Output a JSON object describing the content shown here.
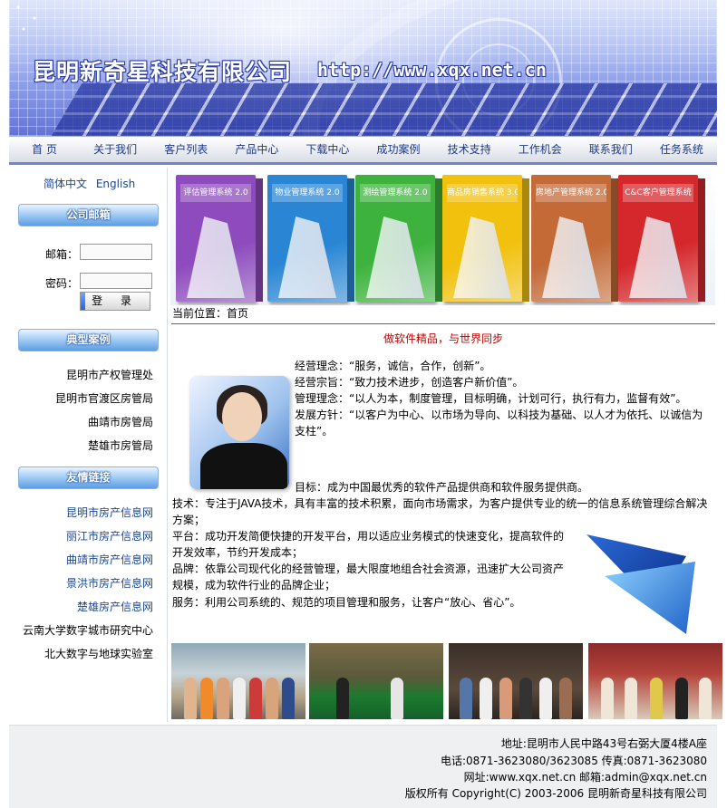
{
  "banner": {
    "company_name": "昆明新奇星科技有限公司",
    "url": "http://www.xqx.net.cn"
  },
  "nav": {
    "items": [
      "首 页",
      "关于我们",
      "客户列表",
      "产品中心",
      "下载中心",
      "成功案例",
      "技术支持",
      "工作机会",
      "联系我们",
      "任务系统"
    ]
  },
  "sidebar": {
    "lang": {
      "zh": "简体中文",
      "en": "English"
    },
    "mail_header": "公司邮箱",
    "email_label": "邮箱：",
    "password_label": "密码：",
    "email_value": "",
    "password_value": "",
    "login_button": "登 录",
    "cases_header": "典型案例",
    "cases": [
      "昆明市产权管理处",
      "昆明市官渡区房管局",
      "曲靖市房管局",
      "楚雄市房管局"
    ],
    "links_header": "友情链接",
    "links": [
      "昆明市房产信息网",
      "丽江市房产信息网",
      "曲靖市房产信息网",
      "景洪市房产信息网",
      "楚雄房产信息网",
      "云南大学数字城市研究中心",
      "北大数字与地球实验室"
    ]
  },
  "products": [
    {
      "title": "评估管理系统",
      "version": "2.0",
      "color": "#8d4bbd"
    },
    {
      "title": "物业管理系统",
      "version": "2.0",
      "color": "#2a86d4"
    },
    {
      "title": "测绘管理系统",
      "version": "2.0",
      "color": "#3db33d"
    },
    {
      "title": "商品房销售系统",
      "version": "3.0",
      "color": "#f1c10e"
    },
    {
      "title": "房地产管理系统",
      "version": "2.0",
      "color": "#c36a37"
    },
    {
      "title": "C&C客户管理系统",
      "version": "",
      "color": "#d5282c"
    }
  ],
  "main": {
    "breadcrumb": "当前位置：首页",
    "slogan": "做软件精品，与世界同步",
    "lines": [
      "经营理念：“服务，诚信，合作，创新”。",
      "经营宗旨：“致力技术进步，创造客户新价值”。",
      "管理理念：“以人为本，制度管理，目标明确，计划可行，执行有力，监督有效”。",
      "发展方针：“以客户为中心、以市场为导向、以科技为基础、以人才为依托、以诚信为",
      "支柱”。",
      "目标：成为中国最优秀的软件产品提供商和软件服务提供商。",
      "技术：专注于JAVA技术，具有丰富的技术积累，面向市场需求，为客户提供专业的统一的信息系统管理综合解决",
      "方案；",
      "平台：成功开发简便快捷的开发平台，用以适应业务模式的快速变化，提高软件的",
      "开发效率，节约开发成本；",
      "品牌：依靠公司现代化的经营管理，最大限度地组合社会资源，迅速扩大公司资产",
      "规模，成为软件行业的品牌企业；",
      "服务：利用公司系统的、规范的项目管理和服务，让客户“放心、省心”。"
    ]
  },
  "footer": {
    "address": "地址:昆明市人民中路43号右弼大厦4楼A座",
    "phone": "电话:0871-3623080/3623085 传真:0871-3623080",
    "web": "网址:www.xqx.net.cn 邮箱:admin@xqx.net.cn",
    "copyright": "版权所有  Copyright(C) 2003-2006 昆明新奇星科技有限公司"
  }
}
